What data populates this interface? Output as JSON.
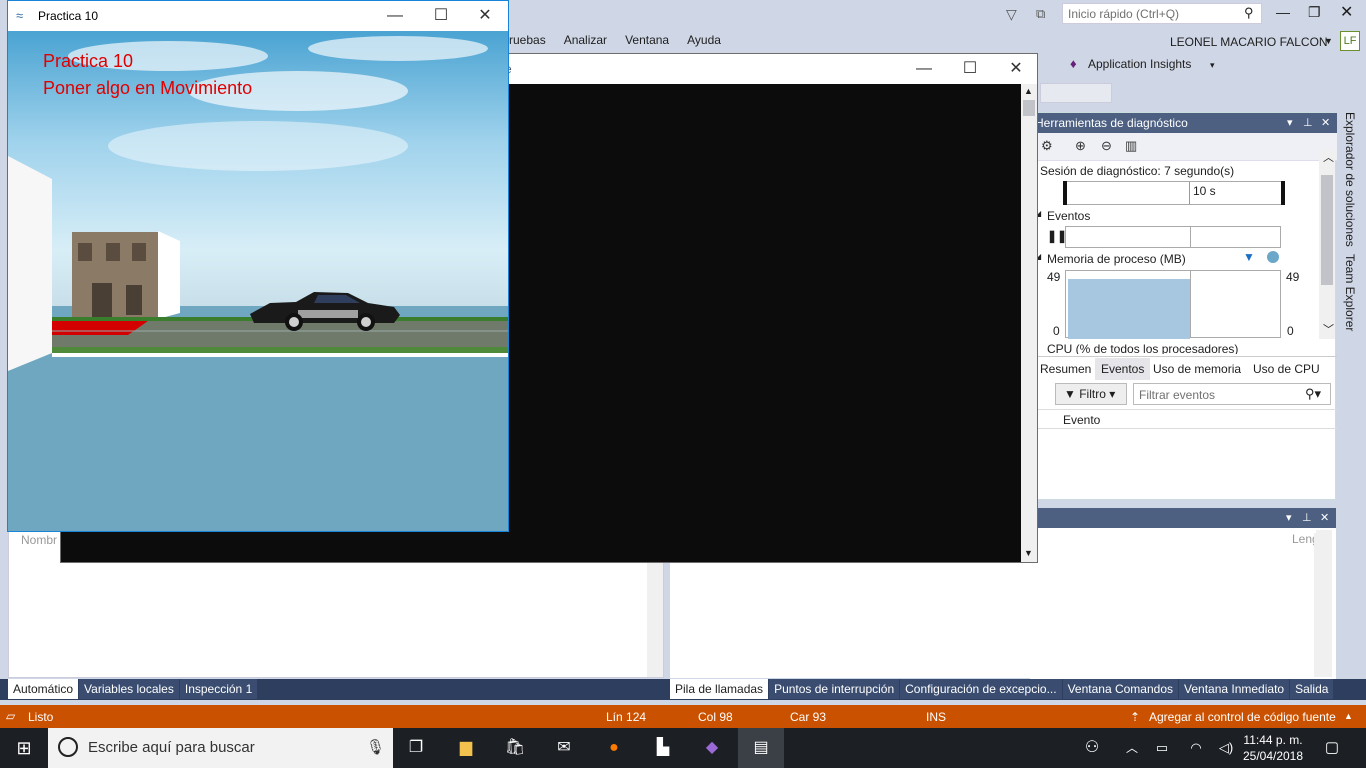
{
  "vs": {
    "menu": [
      "ruebas",
      "Analizar",
      "Ventana",
      "Ayuda"
    ],
    "quick_launch_placeholder": "Inicio rápido (Ctrl+Q)",
    "user_name": "LEONEL MACARIO FALCON",
    "user_initials": "LF",
    "app_insights": "Application Insights"
  },
  "diag": {
    "title": "Herramientas de diagnóstico",
    "session": "Sesión de diagnóstico: 7 segundo(s)",
    "timeline_label": "10 s",
    "events_label": "Eventos",
    "memory_label": "Memoria de proceso (MB)",
    "mem_max_left": "49",
    "mem_min_left": "0",
    "mem_max_right": "49",
    "mem_min_right": "0",
    "cpu_label": "CPU (% de todos los procesadores)",
    "tabs": [
      "Resumen",
      "Eventos",
      "Uso de memoria",
      "Uso de CPU"
    ],
    "filter_label": "Filtro",
    "filter_placeholder": "Filtrar eventos",
    "column_event": "Evento"
  },
  "side_tabs": [
    "Explorador de soluciones",
    "Team Explorer"
  ],
  "panel2": {
    "col_right": "Leng"
  },
  "left_pane": {
    "col_name": "Nombr"
  },
  "bottom_tabs_left": [
    "Automático",
    "Variables locales",
    "Inspección 1"
  ],
  "bottom_tabs_right": [
    "Pila de llamadas",
    "Puntos de interrupción",
    "Configuración de excepcio...",
    "Ventana Comandos",
    "Ventana Inmediato",
    "Salida"
  ],
  "status": {
    "ready": "Listo",
    "line": "Lín 124",
    "col": "Col 98",
    "car": "Car 93",
    "ins": "INS",
    "source_control": "Agregar al control de código fuente"
  },
  "taskbar": {
    "search_placeholder": "Escribe aquí para buscar",
    "time": "11:44 p. m.",
    "date": "25/04/2018"
  },
  "practica": {
    "window_title": "Practica 10",
    "heading": "Practica 10",
    "subheading": "Poner algo en Movimiento"
  },
  "console": {
    "title_fragment": "e"
  }
}
